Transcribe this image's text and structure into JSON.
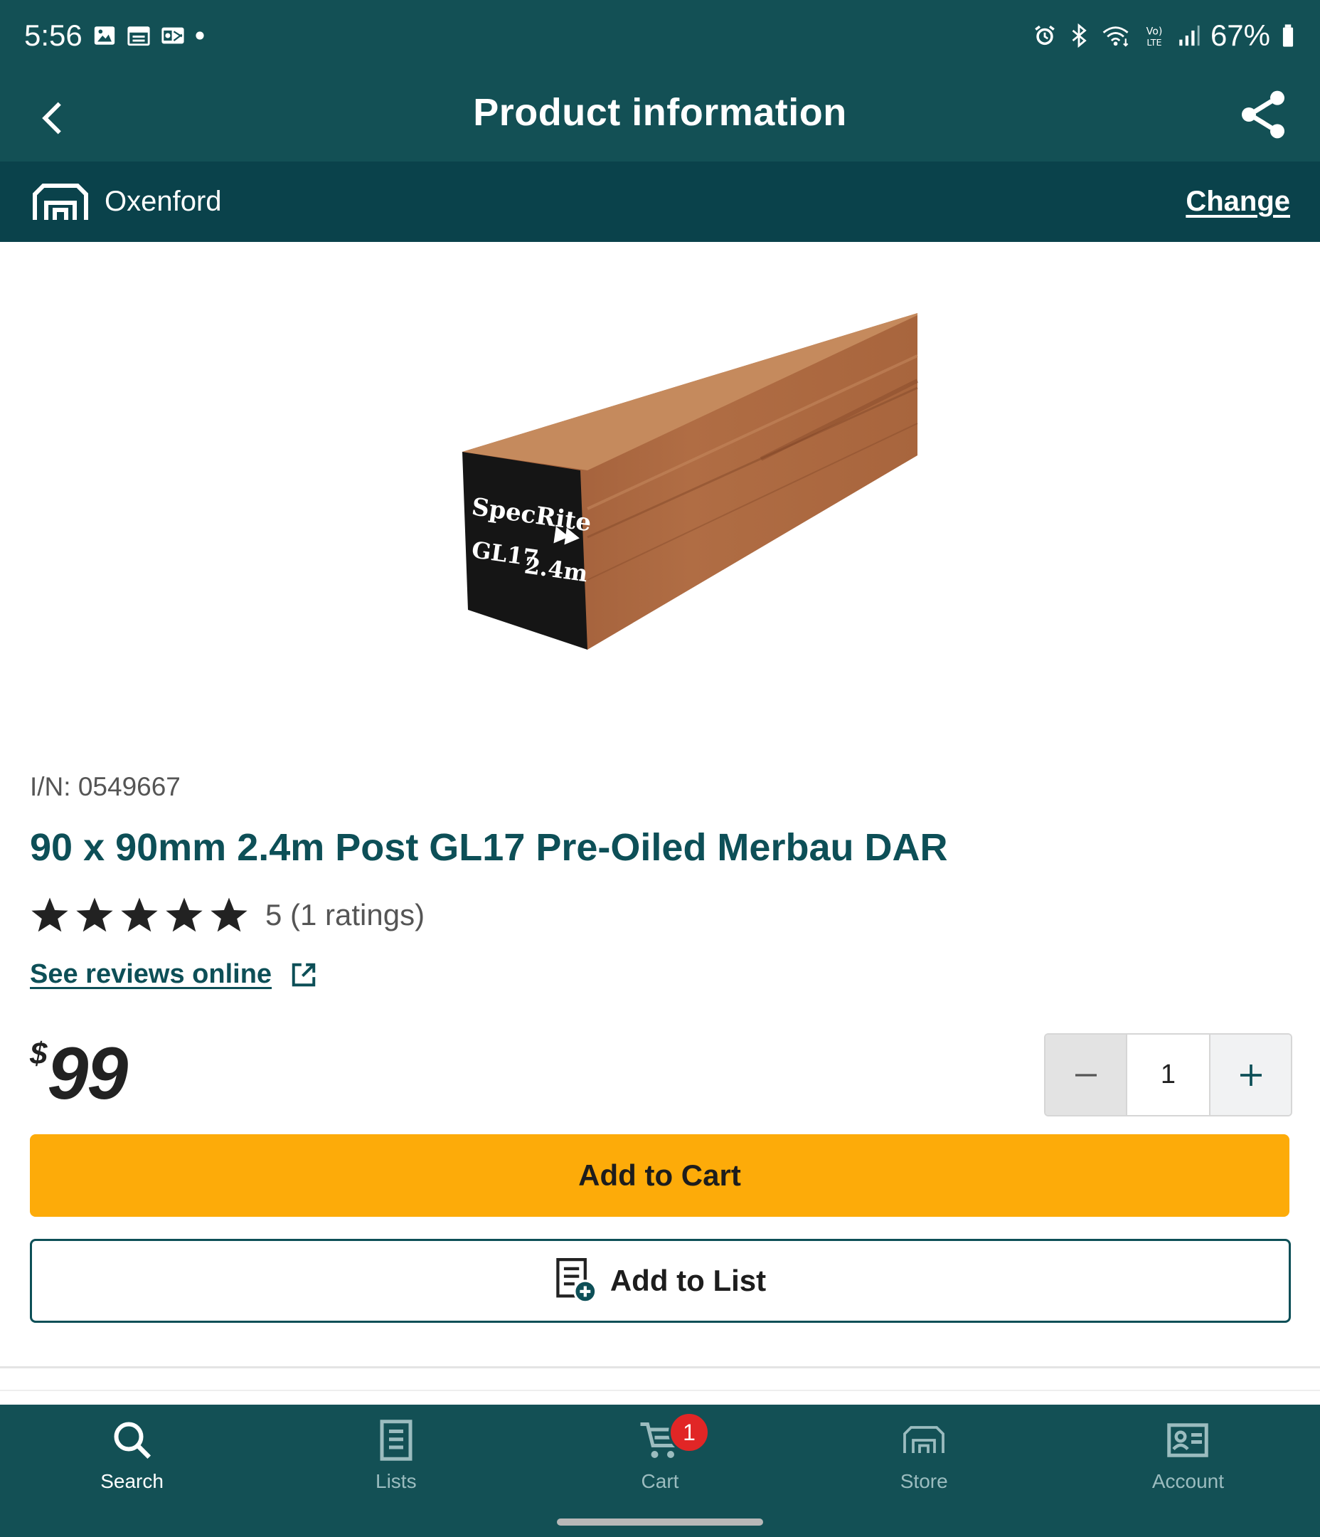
{
  "status_bar": {
    "time": "5:56",
    "battery": "67%",
    "left_icons": [
      "gallery-icon",
      "calendar-icon",
      "outlook-icon",
      "dot-icon"
    ],
    "right_icons": [
      "alarm-icon",
      "bluetooth-icon",
      "wifi-icon",
      "volte-icon",
      "signal-icon",
      "battery-icon"
    ]
  },
  "app_bar": {
    "title": "Product information",
    "back_icon": "chevron-left-icon",
    "share_icon": "share-icon"
  },
  "store": {
    "name": "Oxenford",
    "change_label": "Change",
    "icon": "store-icon"
  },
  "product": {
    "image_label_brand": "SpecRite",
    "image_label_grade": "GL17",
    "image_label_length": "2.4m",
    "item_number": "I/N: 0549667",
    "title": "90 x 90mm 2.4m Post GL17 Pre-Oiled Merbau DAR",
    "rating_text": "5 (1 ratings)",
    "rating_stars": 5,
    "reviews_link": "See reviews online",
    "price_currency": "$",
    "price_amount": "99"
  },
  "quantity": {
    "value": "1"
  },
  "actions": {
    "add_to_cart": "Add to Cart",
    "add_to_list": "Add to List"
  },
  "bottom_nav": {
    "items": [
      {
        "label": "Search",
        "icon": "search-icon",
        "active": true
      },
      {
        "label": "Lists",
        "icon": "list-icon",
        "active": false
      },
      {
        "label": "Cart",
        "icon": "cart-icon",
        "active": false,
        "badge": "1"
      },
      {
        "label": "Store",
        "icon": "store-icon",
        "active": false
      },
      {
        "label": "Account",
        "icon": "account-icon",
        "active": false
      }
    ]
  },
  "colors": {
    "primary": "#135055",
    "store_bar": "#0a424b",
    "accent": "#fdab09",
    "title_text": "#0d4f57",
    "badge": "#e12626"
  }
}
